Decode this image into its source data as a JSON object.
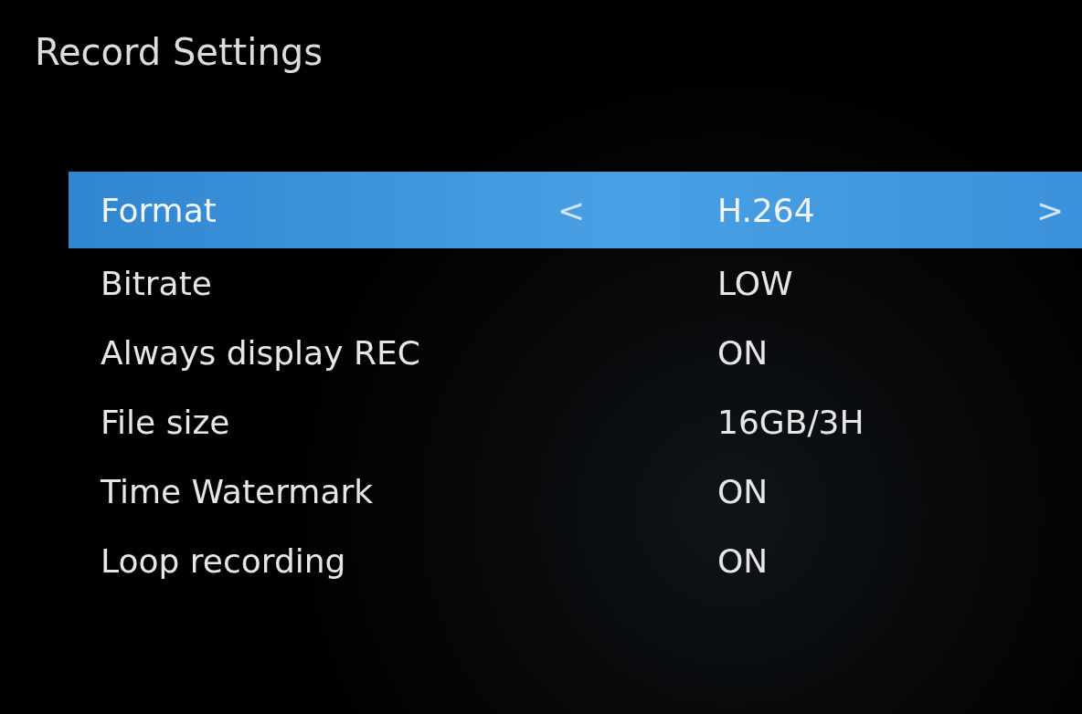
{
  "title": "Record Settings",
  "rows": [
    {
      "label": "Format",
      "value": "H.264",
      "selected": true,
      "prev": "<",
      "next": ">"
    },
    {
      "label": "Bitrate",
      "value": "LOW",
      "selected": false
    },
    {
      "label": "Always display REC",
      "value": "ON",
      "selected": false
    },
    {
      "label": "File size",
      "value": "16GB/3H",
      "selected": false
    },
    {
      "label": "Time Watermark",
      "value": "ON",
      "selected": false
    },
    {
      "label": "Loop recording",
      "value": "ON",
      "selected": false
    }
  ]
}
